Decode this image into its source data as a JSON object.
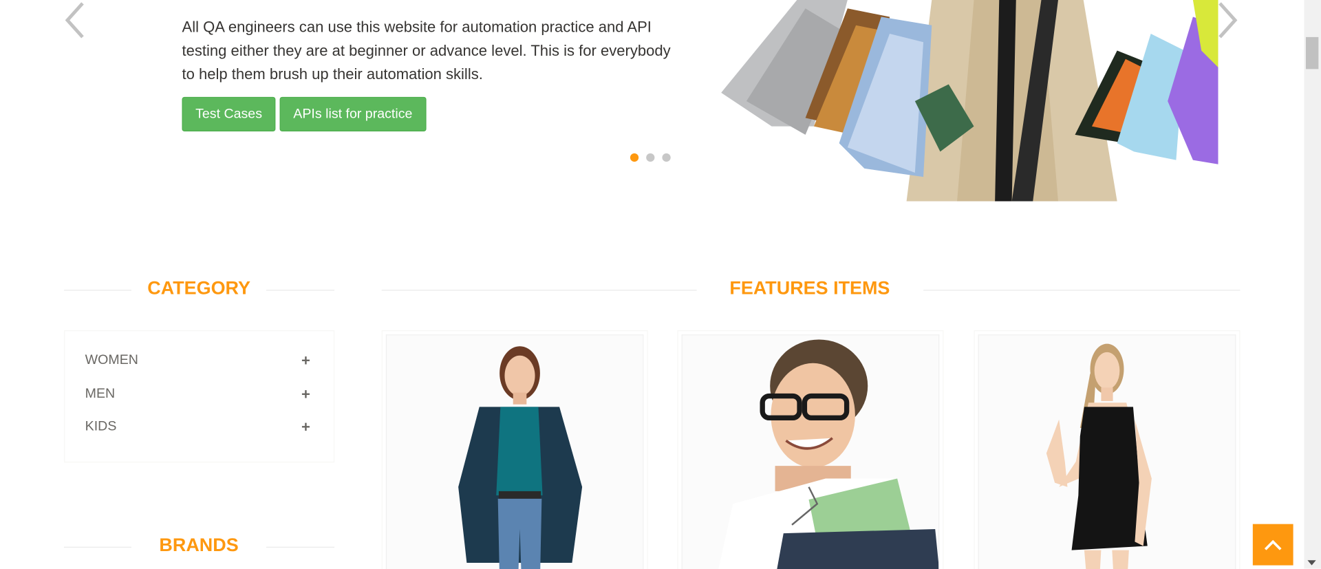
{
  "slider": {
    "description": "All QA engineers can use this website for automation practice and API testing either they are at beginner or advance level. This is for everybody to help them brush up their automation skills.",
    "test_cases_label": "Test Cases",
    "apis_label": "APIs list for practice",
    "indicator_count": 3,
    "active_indicator": 0
  },
  "category": {
    "title": "Category",
    "items": [
      {
        "label": "WOMEN"
      },
      {
        "label": "MEN"
      },
      {
        "label": "KIDS"
      }
    ]
  },
  "brands": {
    "title": "Brands"
  },
  "features": {
    "title": "Features Items"
  },
  "colors": {
    "accent": "#FE980F",
    "button_green": "#5CB85C",
    "text": "#363432",
    "muted_text": "#696763"
  },
  "icons": {
    "prev": "chevron-left-icon",
    "next": "chevron-right-icon",
    "plus": "plus-icon",
    "scroll_up": "chevron-up-icon"
  }
}
